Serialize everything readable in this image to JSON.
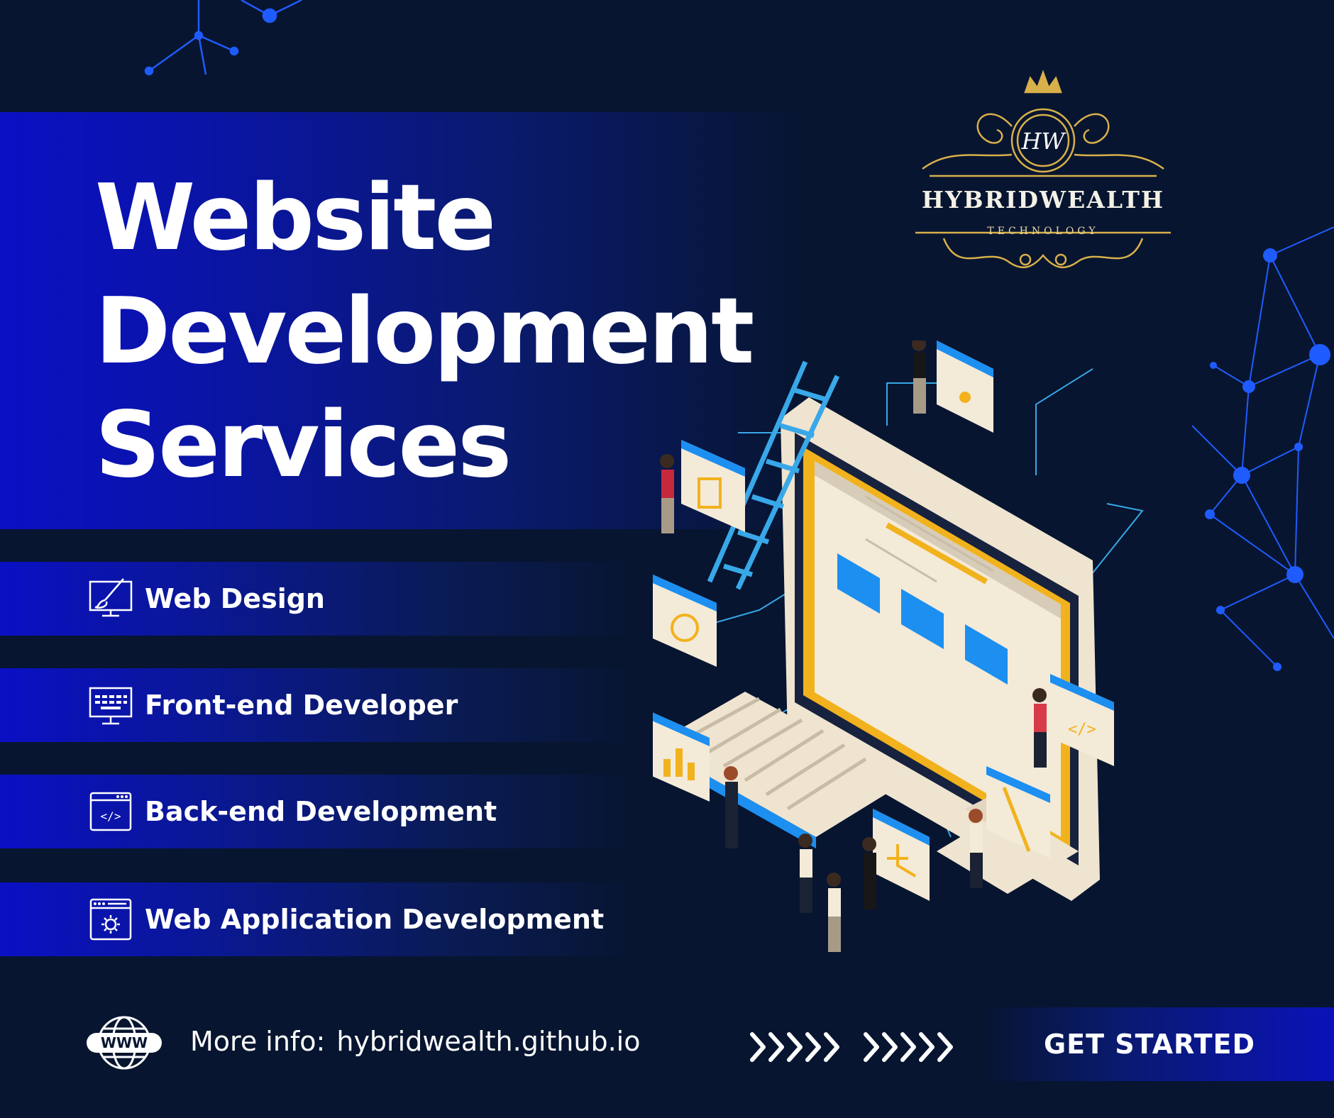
{
  "headline": {
    "line1": "Website",
    "line2": "Development",
    "line3": "Services"
  },
  "services": [
    {
      "label": "Web Design",
      "icon": "monitor-paintbrush-icon"
    },
    {
      "label": "Front-end Developer",
      "icon": "monitor-keyboard-icon"
    },
    {
      "label": "Back-end Development",
      "icon": "code-window-icon"
    },
    {
      "label": "Web Application Development",
      "icon": "browser-gear-icon"
    }
  ],
  "logo": {
    "monogram": "HW",
    "name": "HYBRIDWEALTH",
    "tagline": "TECHNOLOGY"
  },
  "footer": {
    "more_info_label": "More info:",
    "url": "hybridwealth.github.io",
    "globe_text": "WWW",
    "cta": "GET STARTED",
    "arrows": "»»»»»»»»»",
    "arrow_icon": "double-chevron-icon"
  },
  "colors": {
    "background": "#071530",
    "band_blue": "#0a10c4",
    "accent_gold": "#d8b04a",
    "network_blue": "#1f5cff",
    "text": "#ffffff"
  }
}
